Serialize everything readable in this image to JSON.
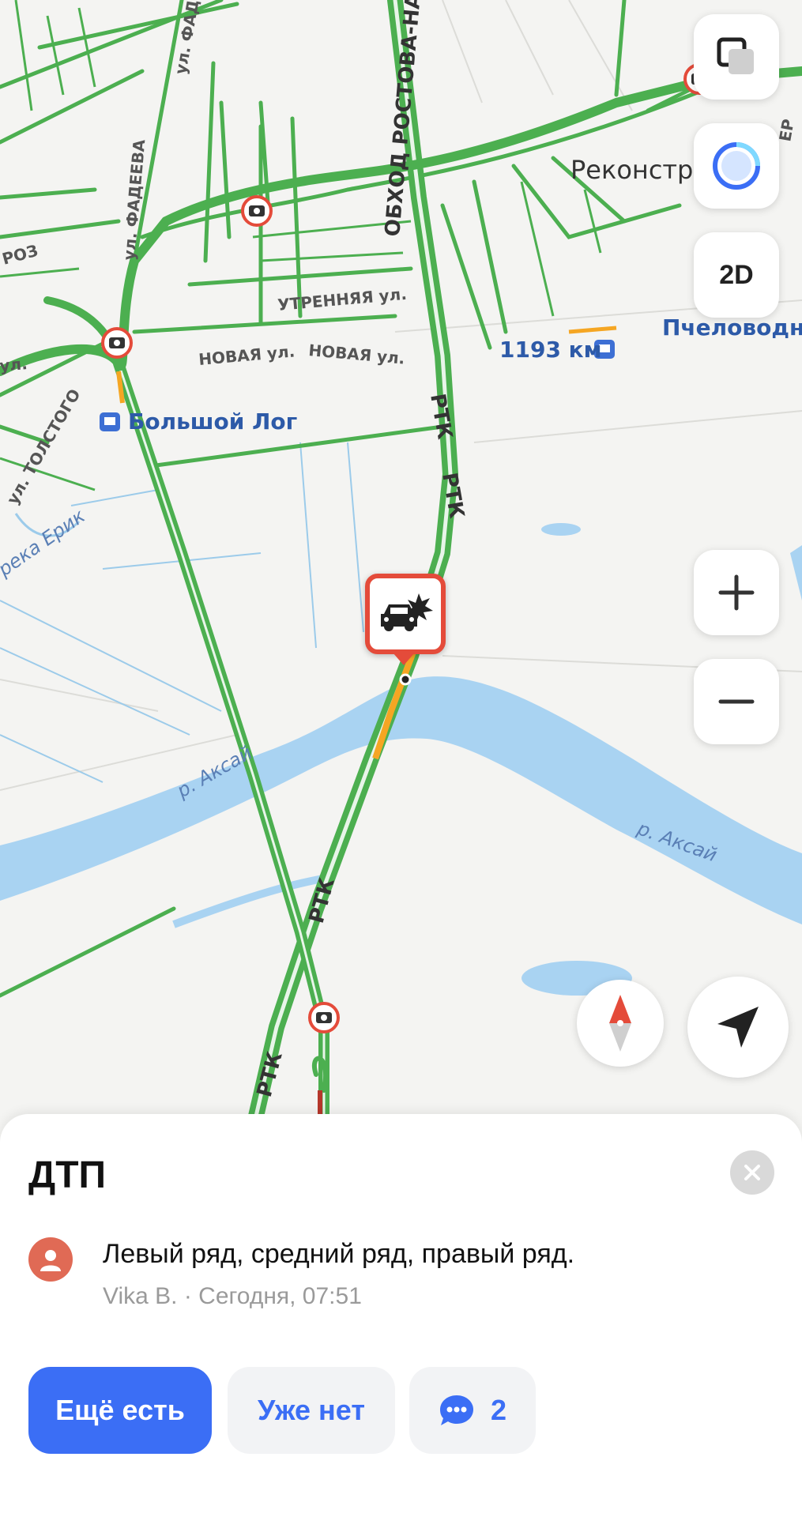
{
  "map": {
    "labels": {
      "street_fadeeva_1": "ул. ФАДЕЕВА",
      "street_fadeeva_2": "ул. ФАДЕЕВА",
      "street_obkhod": "ОБХОД РОСТОВА-НА",
      "street_roz": "РОЗ",
      "street_utrennyaya": "УТРЕННЯЯ ул.",
      "street_novaya_1": "НОВАЯ ул.",
      "street_novaya_2": "НОВАЯ ул.",
      "street_ul": "ул.",
      "street_tolstogo": "ул. ТОЛСТОГО",
      "river_erik": "река Ерик",
      "road_rtk_1": "РТК",
      "road_rtk_2": "РТК",
      "road_rtk_3": "РТК",
      "road_rtk_4": "РТК",
      "place_rekonstr": "Реконстру",
      "place_pchelovod": "Пчеловодна",
      "station_1193": "1193 км",
      "station_bolshoy_log": "Большой Лог",
      "river_aksay_1": "р. Аксай",
      "river_aksay_2": "р. Аксай",
      "edge_r": "ЕР"
    },
    "controls": {
      "mode_label": "2D",
      "zoom_in_symbol": "+",
      "zoom_out_symbol": "−"
    },
    "colors": {
      "road_traffic_free": "#4caf50",
      "road_traffic_slow": "#f5a623",
      "road_traffic_jam": "#b5372b",
      "water": "#a9d3f2",
      "incident": "#e44b3a"
    }
  },
  "incident": {
    "title": "ДТП",
    "comment": "Левый ряд, средний ряд, правый ряд.",
    "author_line": "Vika B. · Сегодня, 07:51",
    "buttons": {
      "still_there": "Ещё есть",
      "gone": "Уже нет",
      "comments_count": "2"
    }
  }
}
